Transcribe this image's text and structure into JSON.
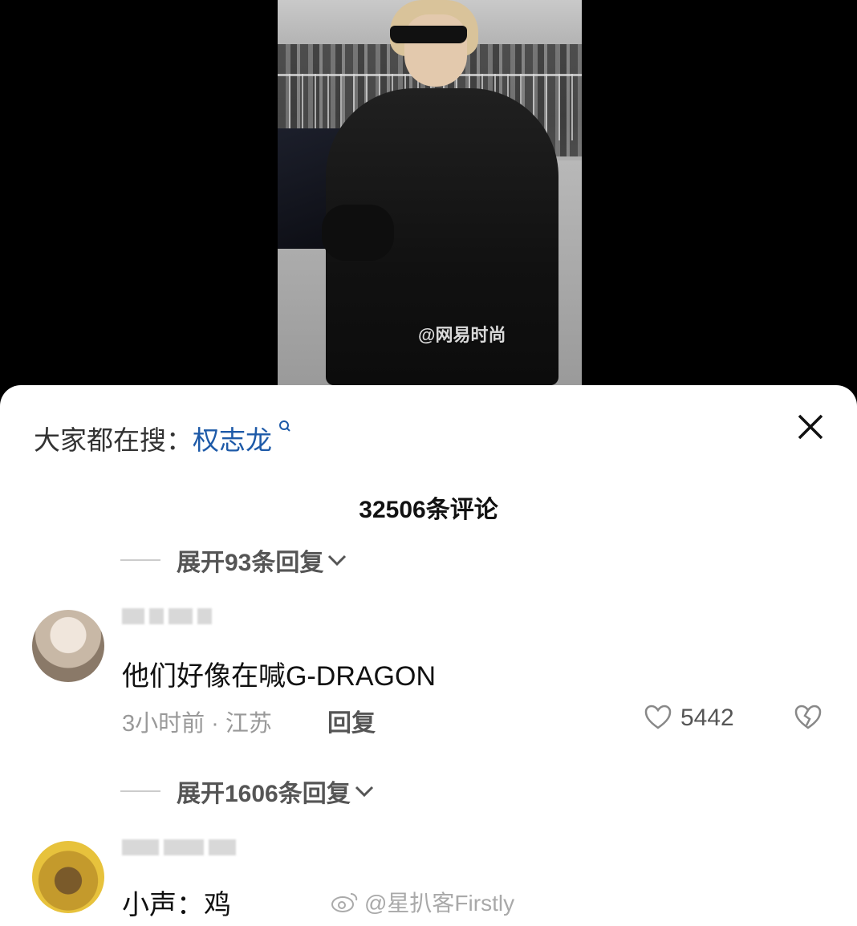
{
  "video": {
    "watermark": "@网易时尚"
  },
  "sheet": {
    "search_prefix": "大家都在搜：",
    "search_term": "权志龙",
    "comment_count": "32506条评论",
    "expand_1": "展开93条回复",
    "comment_1": {
      "text": "他们好像在喊G-DRAGON",
      "meta": "3小时前 · 江苏",
      "reply_label": "回复",
      "likes": "5442"
    },
    "expand_2": "展开1606条回复",
    "comment_2": {
      "text": "小声：鸡"
    },
    "watermark": "@星扒客Firstly"
  }
}
